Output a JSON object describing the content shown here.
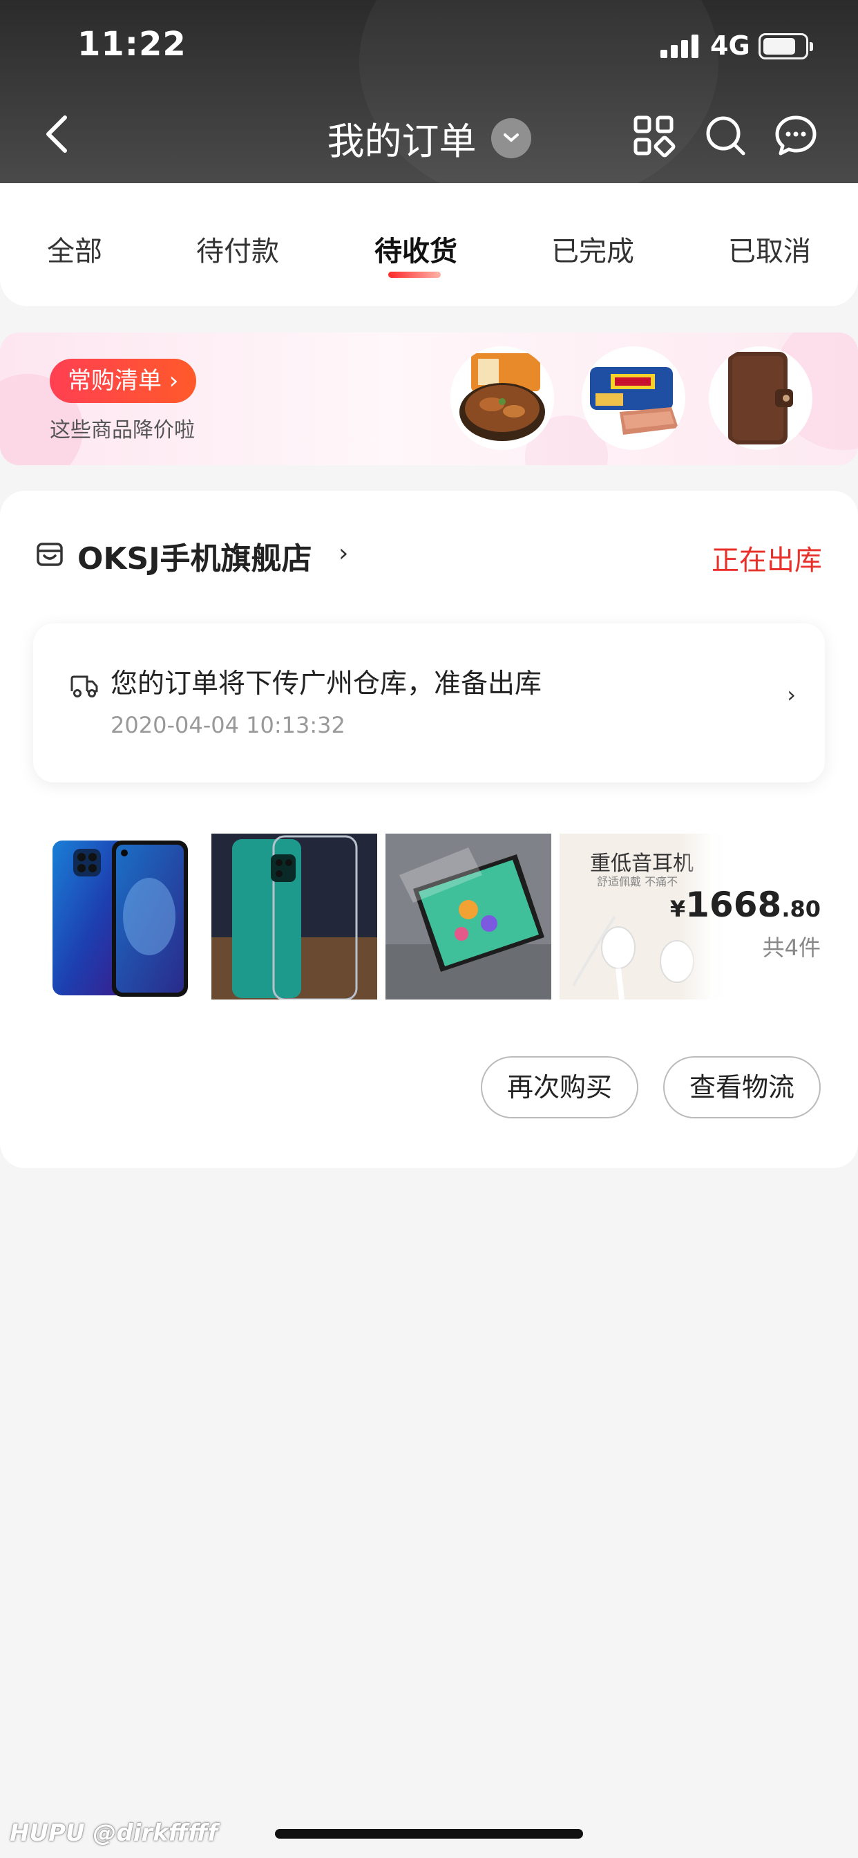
{
  "status_bar": {
    "time": "11:22",
    "network": "4G"
  },
  "nav": {
    "title": "我的订单"
  },
  "tabs": [
    {
      "label": "全部"
    },
    {
      "label": "待付款"
    },
    {
      "label": "待收货",
      "active": true
    },
    {
      "label": "已完成"
    },
    {
      "label": "已取消"
    }
  ],
  "promo": {
    "button_label": "常购清单 ›",
    "subtitle": "这些商品降价啦"
  },
  "order": {
    "shop_name": "OKSJ手机旗舰店",
    "shop_arrow": "›",
    "status": "正在出库",
    "logistics": {
      "message": "您的订单将下传广州仓库，准备出库",
      "time": "2020-04-04 10:13:32",
      "arrow": "›"
    },
    "product_image_text": {
      "title": "重低音耳机",
      "subtitle": "舒适佩戴 不痛不"
    },
    "price": {
      "currency": "¥",
      "integer": "1668",
      "decimal": ".80"
    },
    "item_count": "共4件",
    "actions": {
      "rebuy": "再次购买",
      "track": "查看物流"
    }
  },
  "watermark": "HUPU @dirkfffff",
  "colors": {
    "accent": "#e8312a",
    "header_bg": "#333333"
  }
}
